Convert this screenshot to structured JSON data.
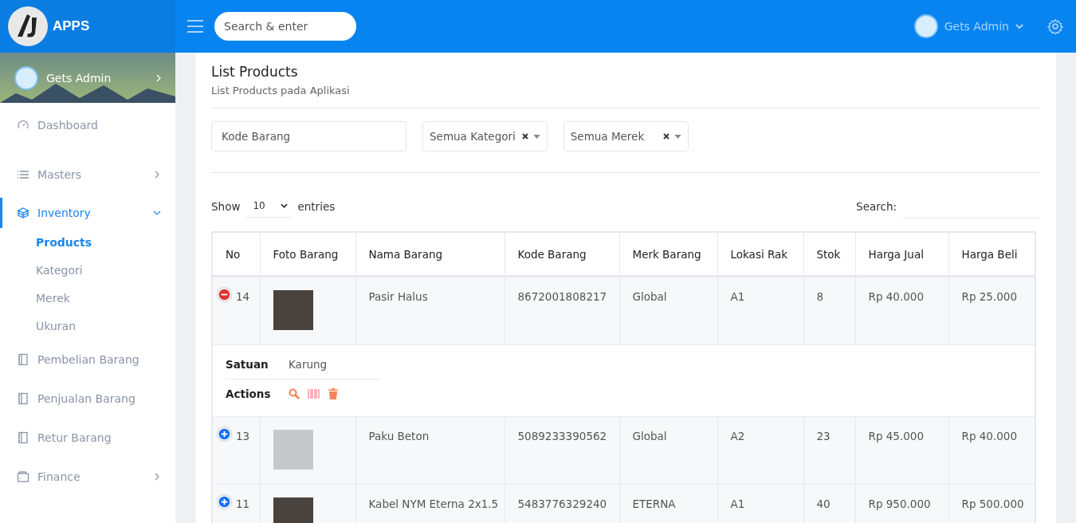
{
  "brand": {
    "name": "APPS"
  },
  "topbar": {
    "search_placeholder": "Search & enter",
    "user": "Gets Admin"
  },
  "sidebar": {
    "user": "Gets Admin",
    "items": [
      {
        "label": "Dashboard",
        "selected": false
      },
      {
        "label": "Masters",
        "selected": false,
        "expanded": false
      },
      {
        "label": "Inventory",
        "selected": true,
        "expanded": true,
        "children": [
          {
            "label": "Products",
            "selected": true
          },
          {
            "label": "Kategori",
            "selected": false
          },
          {
            "label": "Merek",
            "selected": false
          },
          {
            "label": "Ukuran",
            "selected": false
          }
        ]
      },
      {
        "label": "Pembelian Barang",
        "selected": false
      },
      {
        "label": "Penjualan Barang",
        "selected": false
      },
      {
        "label": "Retur Barang",
        "selected": false
      },
      {
        "label": "Finance",
        "selected": false,
        "expanded": false
      }
    ]
  },
  "page": {
    "title": "List Products",
    "subtitle": "List Products pada Aplikasi"
  },
  "filters": {
    "code_placeholder": "Kode Barang",
    "category": "Semua Kategori",
    "brand": "Semua Merek"
  },
  "table_controls": {
    "show": "Show",
    "entries_value": "10",
    "entries": "entries",
    "search_label": "Search:"
  },
  "table": {
    "columns": [
      "No",
      "Foto Barang",
      "Nama Barang",
      "Kode Barang",
      "Merk Barang",
      "Lokasi Rak",
      "Stok",
      "Harga Jual",
      "Harga Beli"
    ],
    "rows": [
      {
        "no": "14",
        "name": "Pasir Halus",
        "code": "8672001808217",
        "brand": "Global",
        "rack": "A1",
        "stock": "8",
        "sell": "Rp 40.000",
        "buy": "Rp 25.000",
        "expanded": true,
        "details": {
          "unit_label": "Satuan",
          "unit": "Karung",
          "actions_label": "Actions"
        }
      },
      {
        "no": "13",
        "name": "Paku Beton",
        "code": "5089233390562",
        "brand": "Global",
        "rack": "A2",
        "stock": "23",
        "sell": "Rp 45.000",
        "buy": "Rp 40.000",
        "expanded": false
      },
      {
        "no": "11",
        "name": "Kabel NYM Eterna 2x1.5",
        "code": "5483776329240",
        "brand": "ETERNA",
        "rack": "A1",
        "stock": "40",
        "sell": "Rp 950.000",
        "buy": "Rp 500.000",
        "expanded": false
      }
    ]
  }
}
